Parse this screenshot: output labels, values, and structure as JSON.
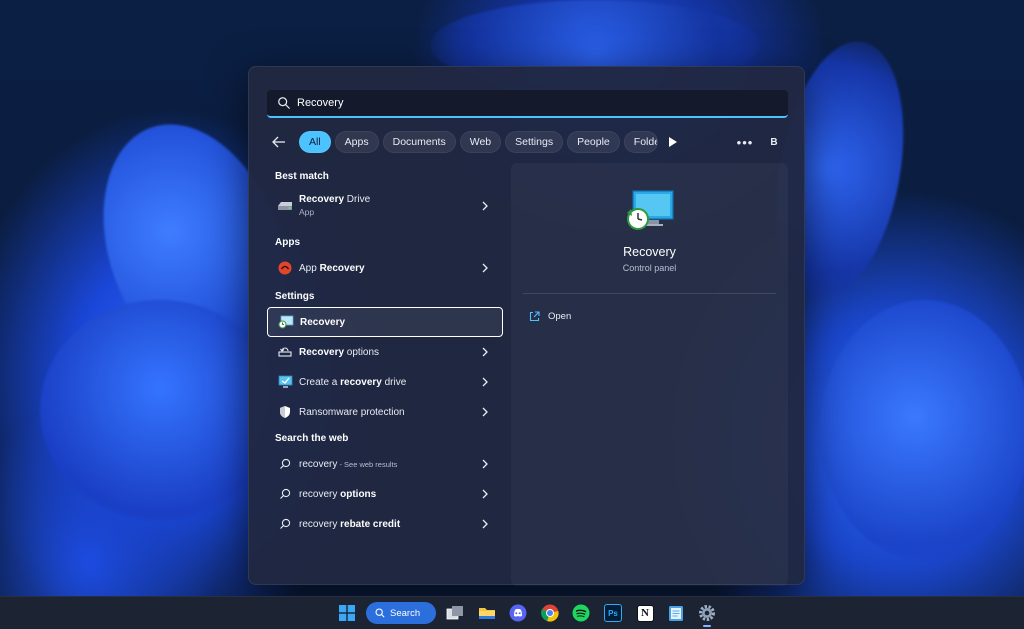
{
  "search": {
    "query": "Recovery"
  },
  "filters": {
    "chips": [
      "All",
      "Apps",
      "Documents",
      "Web",
      "Settings",
      "People",
      "Folde"
    ],
    "active": "All",
    "account_initial": "B",
    "more_label": "•••"
  },
  "results": {
    "best_match": {
      "title": "Best match",
      "item": {
        "name_bold": "Recovery",
        "name_rest": " Drive",
        "sub": "App"
      }
    },
    "apps": {
      "title": "Apps",
      "item": {
        "name_pre": "App ",
        "name_bold": "Recovery"
      }
    },
    "settings": {
      "title": "Settings",
      "items": [
        {
          "pre": "",
          "bold": "Recovery",
          "post": ""
        },
        {
          "pre": "",
          "bold": "Recovery",
          "post": " options"
        },
        {
          "pre": "Create a ",
          "bold": "recovery",
          "post": " drive"
        },
        {
          "pre": "",
          "bold": "",
          "post": "Ransomware protection"
        }
      ]
    },
    "web": {
      "title": "Search the web",
      "items": [
        {
          "pre": "recovery",
          "bold": "",
          "note": " - See web results"
        },
        {
          "pre": "recovery ",
          "bold": "options",
          "note": ""
        },
        {
          "pre": "recovery ",
          "bold": "rebate credit",
          "note": ""
        }
      ]
    }
  },
  "detail": {
    "title": "Recovery",
    "subtitle": "Control panel",
    "action": "Open"
  },
  "taskbar": {
    "search_label": "Search",
    "photoshop_label": "Ps",
    "notion_label": "N"
  },
  "colors": {
    "accent": "#4cc2ff",
    "taskbar_search": "#2a6fdc"
  }
}
